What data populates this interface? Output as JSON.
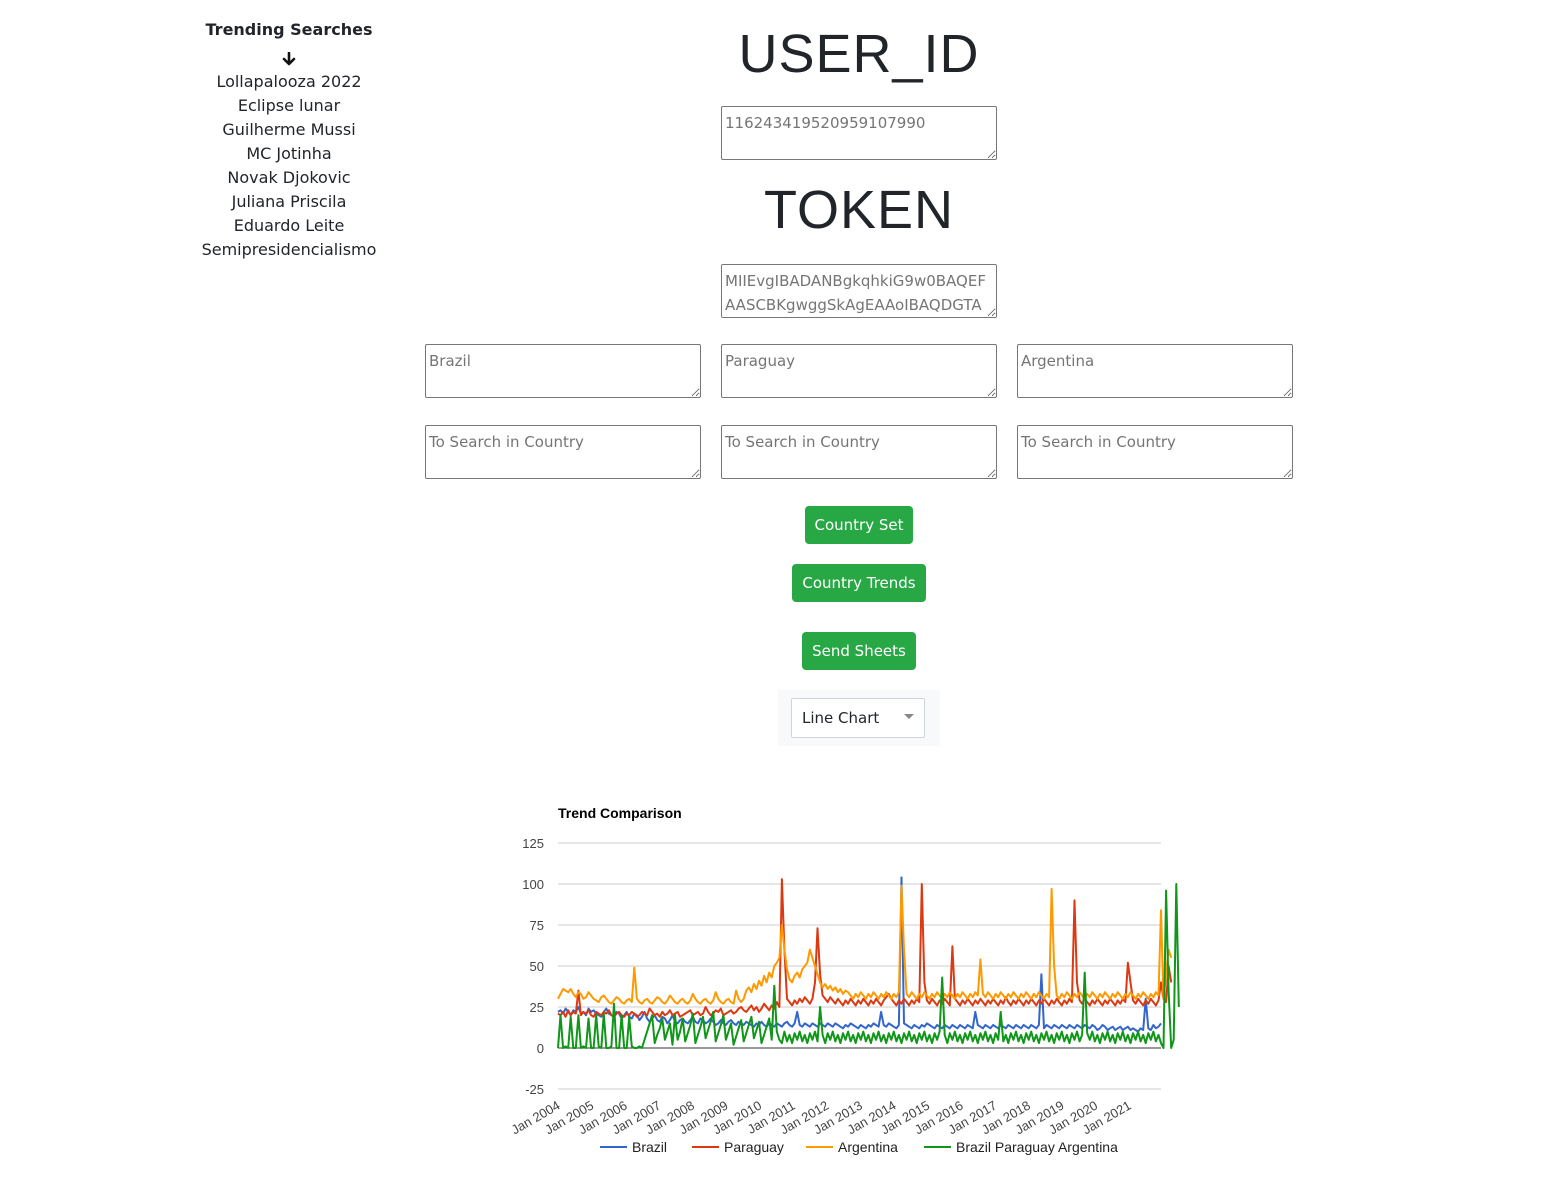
{
  "sidebar": {
    "title": "Trending Searches",
    "items": [
      "Lollapalooza 2022",
      "Eclipse lunar",
      "Guilherme Mussi",
      "MC Jotinha",
      "Novak Djokovic",
      "Juliana Priscila",
      "Eduardo Leite",
      "Semipresidencialismo"
    ]
  },
  "user": {
    "heading": "USER_ID",
    "value": "116243419520959107990"
  },
  "token": {
    "heading": "TOKEN",
    "value": "MIIEvgIBADANBgkqhkiG9w0BAQEF\nAASCBKgwggSkAgEAAoIBAQDGTA"
  },
  "countries": [
    {
      "name": "Brazil",
      "search_placeholder": "To Search in Country"
    },
    {
      "name": "Paraguay",
      "search_placeholder": "To Search in Country"
    },
    {
      "name": "Argentina",
      "search_placeholder": "To Search in Country"
    }
  ],
  "buttons": {
    "country_set": "Country Set",
    "country_trends": "Country Trends",
    "send_sheets": "Send Sheets"
  },
  "chart_type_select": {
    "selected": "Line Chart"
  },
  "chart_data": {
    "type": "line",
    "title": "Trend Comparison",
    "xlabel": "",
    "ylabel": "",
    "ylim": [
      -25,
      125
    ],
    "yticks": [
      -25,
      0,
      25,
      50,
      75,
      100,
      125
    ],
    "grid": true,
    "legend_position": "bottom",
    "x_tick_labels": [
      "Jan 2004",
      "Jan 2005",
      "Jan 2006",
      "Jan 2007",
      "Jan 2008",
      "Jan 2009",
      "Jan 2010",
      "Jan 2011",
      "Jan 2012",
      "Jan 2013",
      "Jan 2014",
      "Jan 2015",
      "Jan 2016",
      "Jan 2017",
      "Jan 2018",
      "Jan 2019",
      "Jan 2020",
      "Jan 2021"
    ],
    "series": [
      {
        "name": "Brazil",
        "color": "#3366cc",
        "values": [
          22,
          23,
          21,
          24,
          22,
          20,
          23,
          22,
          25,
          21,
          22,
          20,
          24,
          22,
          23,
          21,
          20,
          19,
          22,
          24,
          21,
          20,
          19,
          22,
          21,
          18,
          20,
          22,
          19,
          18,
          21,
          20,
          17,
          19,
          22,
          18,
          16,
          18,
          20,
          17,
          16,
          19,
          18,
          15,
          17,
          20,
          16,
          15,
          17,
          18,
          16,
          15,
          17,
          19,
          16,
          15,
          18,
          17,
          15,
          16,
          18,
          16,
          14,
          15,
          17,
          15,
          14,
          16,
          17,
          15,
          14,
          16,
          15,
          14,
          16,
          15,
          14,
          13,
          15,
          14,
          16,
          14,
          13,
          15,
          14,
          13,
          15,
          14,
          13,
          15,
          16,
          14,
          13,
          15,
          22,
          14,
          13,
          15,
          14,
          13,
          15,
          14,
          13,
          15,
          14,
          13,
          15,
          14,
          13,
          15,
          14,
          13,
          12,
          14,
          13,
          15,
          14,
          13,
          12,
          14,
          13,
          12,
          14,
          13,
          15,
          14,
          13,
          22,
          14,
          13,
          15,
          14,
          13,
          12,
          14,
          104,
          15,
          14,
          13,
          12,
          14,
          13,
          12,
          14,
          13,
          15,
          14,
          13,
          12,
          14,
          13,
          12,
          14,
          13,
          12,
          14,
          13,
          12,
          14,
          13,
          12,
          14,
          13,
          12,
          22,
          14,
          13,
          12,
          14,
          13,
          12,
          14,
          13,
          12,
          14,
          13,
          12,
          14,
          13,
          12,
          14,
          13,
          12,
          14,
          13,
          12,
          14,
          13,
          12,
          14,
          45,
          12,
          14,
          13,
          12,
          14,
          13,
          12,
          14,
          13,
          12,
          14,
          13,
          12,
          14,
          13,
          12,
          14,
          13,
          12,
          14,
          13,
          11,
          12,
          14,
          13,
          11,
          12,
          13,
          11,
          12,
          13,
          11,
          12,
          13,
          11,
          12,
          11,
          10,
          12,
          11,
          30,
          12,
          11,
          14,
          12,
          13,
          15
        ]
      },
      {
        "name": "Paraguay",
        "color": "#dc3912",
        "values": [
          21,
          20,
          22,
          19,
          23,
          20,
          22,
          21,
          35,
          20,
          22,
          21,
          23,
          20,
          19,
          22,
          21,
          20,
          22,
          21,
          23,
          20,
          19,
          21,
          22,
          20,
          19,
          21,
          20,
          22,
          21,
          19,
          20,
          22,
          21,
          20,
          24,
          22,
          20,
          21,
          19,
          22,
          20,
          21,
          23,
          20,
          21,
          22,
          19,
          20,
          21,
          22,
          23,
          20,
          21,
          22,
          20,
          21,
          25,
          22,
          20,
          21,
          23,
          22,
          24,
          20,
          21,
          22,
          23,
          21,
          22,
          24,
          25,
          23,
          22,
          24,
          26,
          23,
          25,
          22,
          24,
          27,
          25,
          23,
          26,
          24,
          28,
          25,
          103,
          60,
          30,
          28,
          26,
          29,
          27,
          30,
          28,
          31,
          29,
          27,
          30,
          40,
          73,
          45,
          32,
          30,
          28,
          31,
          29,
          27,
          30,
          28,
          26,
          29,
          27,
          30,
          28,
          26,
          29,
          27,
          30,
          28,
          26,
          29,
          27,
          30,
          28,
          26,
          29,
          31,
          33,
          30,
          28,
          26,
          29,
          27,
          30,
          28,
          26,
          29,
          27,
          30,
          28,
          100,
          40,
          29,
          27,
          30,
          28,
          26,
          29,
          27,
          30,
          28,
          26,
          62,
          30,
          28,
          26,
          29,
          27,
          30,
          28,
          26,
          29,
          27,
          30,
          28,
          26,
          29,
          27,
          30,
          28,
          26,
          29,
          27,
          31,
          28,
          26,
          29,
          27,
          30,
          28,
          26,
          29,
          27,
          30,
          28,
          26,
          29,
          27,
          30,
          28,
          26,
          29,
          27,
          30,
          28,
          26,
          29,
          27,
          30,
          28,
          90,
          40,
          29,
          27,
          30,
          28,
          26,
          29,
          27,
          30,
          28,
          26,
          29,
          27,
          30,
          28,
          26,
          29,
          27,
          30,
          28,
          52,
          40,
          29,
          27,
          30,
          28,
          26,
          29,
          27,
          30,
          28,
          26,
          29,
          40,
          30,
          28,
          50,
          40
        ]
      },
      {
        "name": "Argentina",
        "color": "#ff9900",
        "values": [
          30,
          33,
          36,
          35,
          34,
          36,
          33,
          31,
          34,
          33,
          30,
          31,
          34,
          32,
          30,
          29,
          28,
          31,
          32,
          30,
          28,
          27,
          29,
          31,
          30,
          28,
          27,
          29,
          30,
          28,
          49,
          30,
          28,
          27,
          29,
          30,
          28,
          27,
          29,
          31,
          30,
          28,
          27,
          29,
          32,
          30,
          28,
          27,
          29,
          30,
          28,
          27,
          29,
          33,
          30,
          28,
          27,
          29,
          30,
          28,
          27,
          29,
          34,
          30,
          28,
          27,
          29,
          30,
          28,
          27,
          35,
          30,
          28,
          30,
          35,
          37,
          34,
          39,
          36,
          41,
          38,
          44,
          40,
          46,
          43,
          50,
          52,
          55,
          75,
          60,
          48,
          42,
          40,
          44,
          46,
          43,
          48,
          50,
          52,
          60,
          55,
          50,
          45,
          40,
          37,
          39,
          36,
          38,
          35,
          37,
          34,
          36,
          33,
          35,
          34,
          32,
          30,
          33,
          31,
          34,
          32,
          30,
          33,
          31,
          34,
          32,
          30,
          33,
          31,
          34,
          32,
          30,
          33,
          31,
          34,
          99,
          60,
          33,
          31,
          34,
          32,
          30,
          33,
          31,
          34,
          32,
          30,
          33,
          31,
          34,
          32,
          30,
          33,
          31,
          34,
          32,
          30,
          33,
          31,
          34,
          32,
          30,
          33,
          31,
          34,
          32,
          54,
          33,
          31,
          34,
          32,
          30,
          33,
          31,
          34,
          32,
          30,
          33,
          31,
          34,
          32,
          30,
          33,
          31,
          34,
          32,
          30,
          33,
          31,
          34,
          32,
          30,
          33,
          31,
          97,
          50,
          32,
          30,
          33,
          31,
          34,
          32,
          30,
          33,
          31,
          34,
          32,
          30,
          33,
          31,
          34,
          32,
          30,
          33,
          31,
          34,
          32,
          30,
          33,
          31,
          34,
          32,
          30,
          33,
          31,
          34,
          32,
          30,
          33,
          31,
          34,
          32,
          30,
          33,
          31,
          34,
          32,
          84,
          30,
          45,
          60,
          55
        ]
      },
      {
        "name": "Brazil Paraguay Argentina",
        "color": "#109618",
        "values": [
          0,
          20,
          0,
          1,
          0,
          19,
          0,
          0,
          20,
          0,
          1,
          0,
          18,
          0,
          0,
          20,
          1,
          0,
          21,
          0,
          0,
          1,
          27,
          0,
          0,
          20,
          0,
          0,
          19,
          1,
          0,
          0,
          1,
          0,
          5,
          10,
          15,
          20,
          3,
          8,
          12,
          18,
          5,
          10,
          15,
          2,
          20,
          5,
          10,
          18,
          4,
          9,
          14,
          21,
          3,
          8,
          13,
          19,
          6,
          11,
          16,
          22,
          4,
          9,
          14,
          20,
          5,
          10,
          15,
          2,
          7,
          12,
          17,
          4,
          9,
          14,
          19,
          6,
          11,
          16,
          3,
          8,
          13,
          18,
          5,
          38,
          10,
          5,
          3,
          10,
          4,
          8,
          3,
          9,
          5,
          10,
          4,
          8,
          3,
          9,
          5,
          10,
          4,
          25,
          8,
          3,
          9,
          5,
          10,
          4,
          8,
          3,
          9,
          5,
          10,
          4,
          8,
          3,
          9,
          5,
          10,
          4,
          8,
          3,
          9,
          5,
          10,
          4,
          8,
          3,
          9,
          5,
          10,
          4,
          8,
          3,
          9,
          5,
          10,
          4,
          8,
          3,
          9,
          5,
          10,
          4,
          8,
          3,
          9,
          5,
          10,
          43,
          8,
          3,
          9,
          5,
          10,
          4,
          8,
          3,
          9,
          5,
          10,
          4,
          8,
          3,
          9,
          5,
          10,
          4,
          8,
          3,
          9,
          5,
          22,
          4,
          8,
          3,
          9,
          5,
          10,
          4,
          8,
          3,
          9,
          5,
          10,
          4,
          8,
          3,
          9,
          5,
          10,
          4,
          8,
          3,
          9,
          5,
          10,
          4,
          8,
          3,
          9,
          5,
          10,
          4,
          8,
          46,
          9,
          5,
          10,
          4,
          8,
          3,
          9,
          5,
          10,
          4,
          8,
          3,
          9,
          5,
          10,
          4,
          8,
          3,
          9,
          5,
          10,
          4,
          8,
          3,
          9,
          5,
          10,
          4,
          8,
          3,
          0,
          96,
          35,
          0,
          5,
          100,
          25
        ]
      }
    ]
  }
}
